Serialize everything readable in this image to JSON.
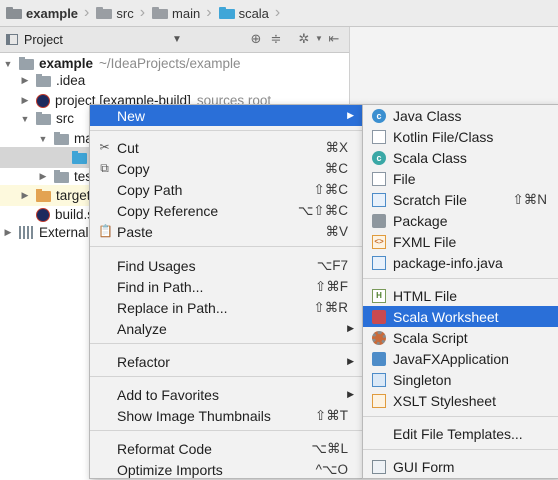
{
  "breadcrumb": [
    {
      "label": "example",
      "bold": true,
      "icon": "project-folder-icon"
    },
    {
      "label": "src",
      "bold": false,
      "icon": "folder-icon"
    },
    {
      "label": "main",
      "bold": false,
      "icon": "folder-icon"
    },
    {
      "label": "scala",
      "bold": false,
      "icon": "source-folder-icon"
    }
  ],
  "project_toolbar": {
    "title": "Project"
  },
  "tree": {
    "root_name": "example",
    "root_path": "~/IdeaProjects/example",
    "idea": ".idea",
    "project_build": "project [example-build]",
    "project_build_note": "sources root",
    "src": "src",
    "main": "main",
    "test": "test",
    "target": "target",
    "build": "build.sbt",
    "external": "External Libraries"
  },
  "context_menu": {
    "new": "New",
    "cut": "Cut",
    "cut_sc": "⌘X",
    "copy": "Copy",
    "copy_sc": "⌘C",
    "copy_path": "Copy Path",
    "copy_path_sc": "⇧⌘C",
    "copy_ref": "Copy Reference",
    "copy_ref_sc": "⌥⇧⌘C",
    "paste": "Paste",
    "paste_sc": "⌘V",
    "find_usages": "Find Usages",
    "find_usages_sc": "⌥F7",
    "find_in_path": "Find in Path...",
    "find_in_path_sc": "⇧⌘F",
    "replace_in_path": "Replace in Path...",
    "replace_in_path_sc": "⇧⌘R",
    "analyze": "Analyze",
    "refactor": "Refactor",
    "add_favorites": "Add to Favorites",
    "show_thumbs": "Show Image Thumbnails",
    "show_thumbs_sc": "⇧⌘T",
    "reformat": "Reformat Code",
    "reformat_sc": "⌥⌘L",
    "optimize": "Optimize Imports",
    "optimize_sc": "^⌥O"
  },
  "submenu": {
    "java_class": "Java Class",
    "kotlin": "Kotlin File/Class",
    "scala_class": "Scala Class",
    "file": "File",
    "scratch": "Scratch File",
    "scratch_sc": "⇧⌘N",
    "package": "Package",
    "fxml": "FXML File",
    "package_info": "package-info.java",
    "html": "HTML File",
    "scala_ws": "Scala Worksheet",
    "scala_script": "Scala Script",
    "javafx": "JavaFXApplication",
    "singleton": "Singleton",
    "xslt": "XSLT Stylesheet",
    "edit_templates": "Edit File Templates...",
    "gui_form": "GUI Form"
  },
  "colors": {
    "selection": "#2a6fd8",
    "source_folder": "#3fa4d6",
    "excluded_folder": "#e3a352"
  }
}
